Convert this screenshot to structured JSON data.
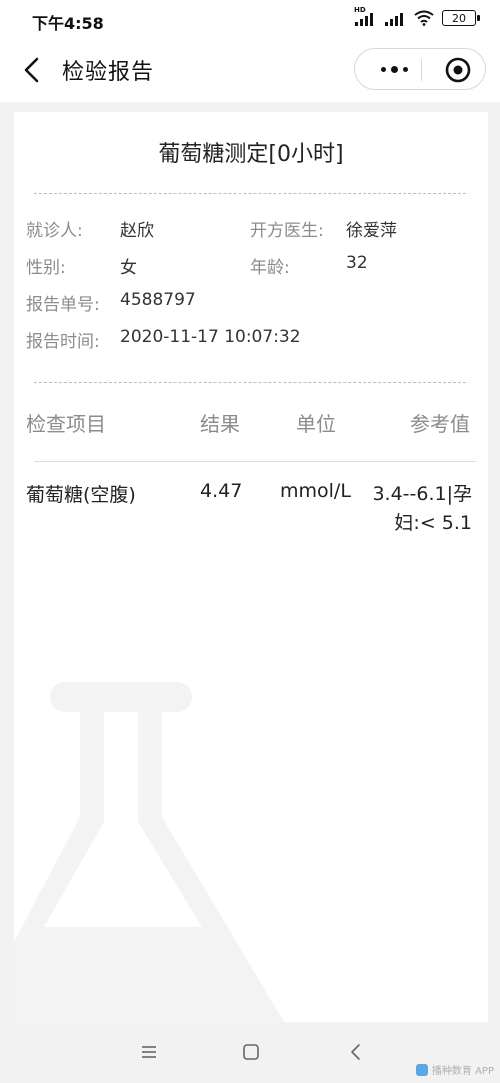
{
  "status_bar": {
    "time": "下午4:58",
    "hd_label": "HD",
    "battery": "20"
  },
  "nav": {
    "title": "检验报告"
  },
  "report": {
    "title": "葡萄糖测定[0小时]",
    "info": {
      "patient_label": "就诊人:",
      "patient_value": "赵欣",
      "doctor_label": "开方医生:",
      "doctor_value": "徐爱萍",
      "gender_label": "性别:",
      "gender_value": "女",
      "age_label": "年龄:",
      "age_value": "32",
      "report_no_label": "报告单号:",
      "report_no_value": "4588797",
      "report_time_label": "报告时间:",
      "report_time_value": "2020-11-17 10:07:32"
    },
    "table": {
      "headers": [
        "检查项目",
        "结果",
        "单位",
        "参考值"
      ],
      "rows": [
        {
          "item": "葡萄糖(空腹)",
          "result": "4.47",
          "unit": "mmol/L",
          "reference_line1": "3.4--6.1|孕",
          "reference_line2": "妇:< 5.1"
        }
      ]
    }
  },
  "watermark": {
    "text": "播种数育 APP"
  },
  "icons": {
    "back": "chevron-left-icon",
    "more": "more-dots-icon",
    "close": "target-close-icon",
    "menu": "menu-icon",
    "home": "home-square-icon",
    "sys_back": "triangle-back-icon",
    "flask": "flask-icon"
  }
}
